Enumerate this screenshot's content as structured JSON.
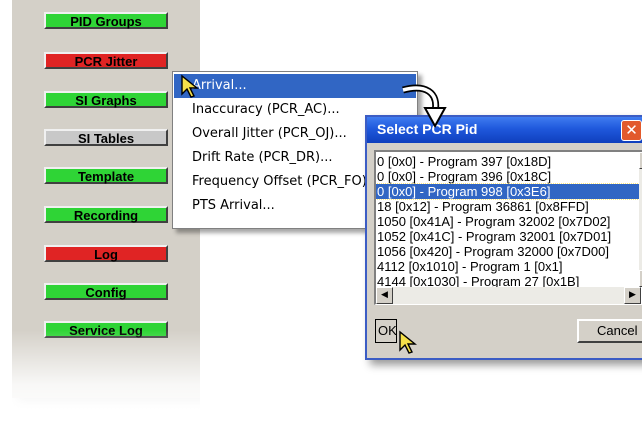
{
  "sidebar": {
    "buttons": [
      {
        "label": "PID Groups",
        "color": "#2fd436"
      },
      {
        "label": "PCR Jitter",
        "color": "#e02424"
      },
      {
        "label": "SI Graphs",
        "color": "#2fd436"
      },
      {
        "label": "SI Tables",
        "color": "#c8c8c8"
      },
      {
        "label": "Template",
        "color": "#2fd436"
      },
      {
        "label": "Recording",
        "color": "#2fd436"
      },
      {
        "label": "Log",
        "color": "#e02424"
      },
      {
        "label": "Config",
        "color": "#2fd436"
      },
      {
        "label": "Service Log",
        "color": "#2fd436"
      }
    ]
  },
  "context_menu": {
    "items": [
      {
        "label": "Arrival...",
        "highlighted": true
      },
      {
        "label": "Inaccuracy (PCR_AC)..."
      },
      {
        "label": "Overall Jitter (PCR_OJ)..."
      },
      {
        "label": "Drift Rate (PCR_DR)..."
      },
      {
        "label": "Frequency Offset (PCR_FO)..."
      },
      {
        "label": "PTS Arrival..."
      }
    ]
  },
  "dialog": {
    "title": "Select PCR Pid",
    "close_glyph": "✕",
    "list_items": [
      "0 [0x0] - Program 397 [0x18D]",
      "0 [0x0] - Program 396 [0x18C]",
      "0 [0x0] - Program 998 [0x3E6]",
      "18 [0x12] - Program 36861 [0x8FFD]",
      "1050 [0x41A] - Program 32002 [0x7D02]",
      "1052 [0x41C] - Program 32001 [0x7D01]",
      "1056 [0x420] - Program 32000 [0x7D00]",
      "4112 [0x1010] - Program 1 [0x1]",
      "4144 [0x1030] - Program 27 [0x1B]"
    ],
    "selected_index": 2,
    "ok_label": "OK",
    "cancel_label": "Cancel"
  },
  "icons": {
    "scroll_up": "▲",
    "scroll_down": "▼",
    "scroll_left": "◀",
    "scroll_right": "▶"
  },
  "colors": {
    "accent_blue": "#3166c4",
    "titlebar_blue": "#1f58dc",
    "panel_gray": "#d4d0c8"
  }
}
